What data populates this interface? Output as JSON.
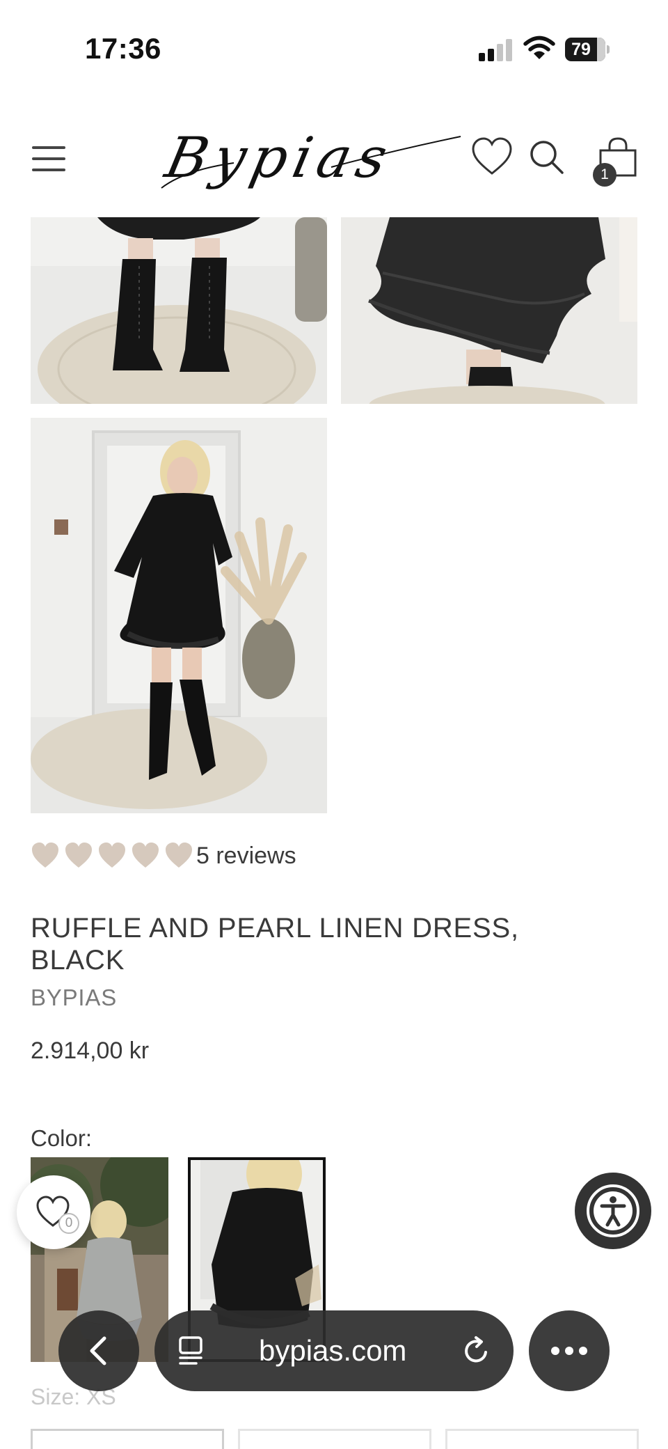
{
  "status_bar": {
    "time": "17:36",
    "battery_percent": 79,
    "battery_label": "79",
    "signal_bars_active": 2,
    "signal_bars_total": 4
  },
  "header": {
    "logo_text": "Bypias",
    "icons": [
      "menu-icon",
      "heart-icon",
      "search-icon",
      "bag-icon"
    ],
    "cart_count": "1"
  },
  "gallery": {
    "images": [
      {
        "name": "dress-boots-closeup"
      },
      {
        "name": "dress-ruffle-hem-closeup"
      },
      {
        "name": "dress-full-length"
      }
    ]
  },
  "product": {
    "rating": 5,
    "rating_max": 5,
    "reviews_label": "5 reviews",
    "title": "RUFFLE AND PEARL LINEN DRESS, BLACK",
    "brand": "BYPIAS",
    "price": "2.914,00 kr",
    "color_label": "Color:",
    "color_swatches": [
      {
        "name": "grey",
        "selected": false
      },
      {
        "name": "black",
        "selected": true
      }
    ],
    "size_label": "Size: XS"
  },
  "wishlist": {
    "count": "0"
  },
  "browser": {
    "url": "bypias.com"
  },
  "colors": {
    "rating_heart": "#d6c9bd",
    "text": "#3a3a3a",
    "muted": "#7a7a7a",
    "toolbar_bg": "#2d2d2d",
    "a11y_bg": "#333333"
  }
}
